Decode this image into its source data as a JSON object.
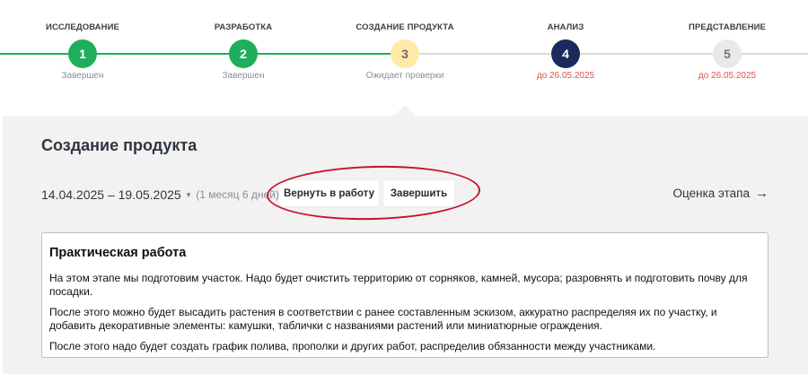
{
  "stepper": {
    "steps": [
      {
        "title": "ИССЛЕДОВАНИЕ",
        "number": "1",
        "status": "Завершен"
      },
      {
        "title": "РАЗРАБОТКА",
        "number": "2",
        "status": "Завершен"
      },
      {
        "title": "СОЗДАНИЕ ПРОДУКТА",
        "number": "3",
        "status": "Ожидает проверки"
      },
      {
        "title": "АНАЛИЗ",
        "number": "4",
        "status": "до 26.05.2025"
      },
      {
        "title": "ПРЕДСТАВЛЕНИЕ",
        "number": "5",
        "status": "до 26.05.2025"
      }
    ]
  },
  "stage": {
    "title": "Создание продукта",
    "date_range": "14.04.2025 – 19.05.2025",
    "duration": "(1 месяц 6 дней)",
    "return_button": "Вернуть в работу",
    "finish_button": "Завершить",
    "evaluation_link": "Оценка этапа",
    "evaluation_arrow": "→"
  },
  "card": {
    "title": "Практическая работа",
    "paragraphs": [
      "На этом этапе мы подготовим участок. Надо будет очистить территорию от сорняков, камней, мусора; разровнять и подготовить почву для посадки.",
      "После этого можно будет высадить растения в соответствии с ранее составленным эскизом, аккуратно распределяя их по участку, и добавить декоративные элементы: камушки, таблички с названиями растений или миниатюрные ограждения.",
      "После этого надо будет создать график полива, прополки и других работ, распределив обязанности между участниками."
    ]
  },
  "colors": {
    "done": "#1fae5c",
    "review": "#ffeaa8",
    "current": "#1b2a5c",
    "pending": "#e9e9e9",
    "deadline": "#d9534f",
    "annotation": "#c8102e"
  }
}
